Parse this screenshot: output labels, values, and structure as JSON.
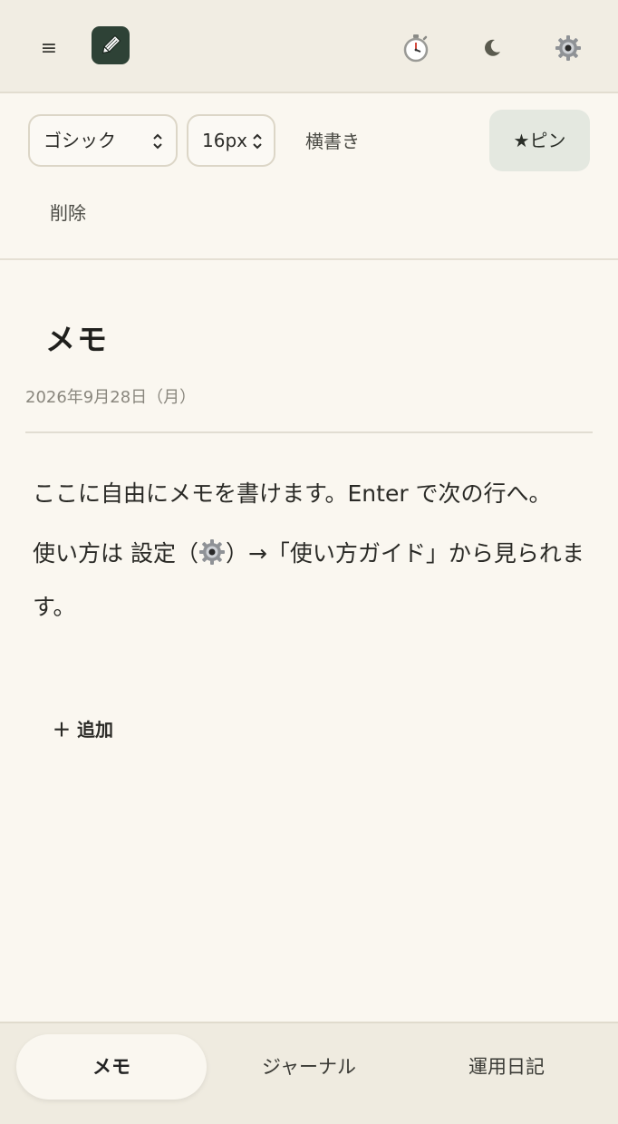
{
  "header": {
    "menu_glyph": "≡",
    "logo_icon": "pencil-icon",
    "timer_icon": "stopwatch-icon",
    "theme_icon": "moon-icon",
    "settings_icon": "gear-icon"
  },
  "toolbar": {
    "font_family": "ゴシック",
    "font_size": "16px",
    "writing_mode": "横書き",
    "pin_label": "★ピン",
    "delete_label": "削除"
  },
  "memo": {
    "title": "メモ",
    "date": "2026年9月28日（月）",
    "line1": "ここに自由にメモを書けます。Enter で次の行へ。",
    "line2_before": "使い方は 設定（",
    "line2_after": "）→「使い方ガイド」から見られます。",
    "add_label": "＋ 追加"
  },
  "tabs": [
    {
      "label": "メモ",
      "active": true
    },
    {
      "label": "ジャーナル",
      "active": false
    },
    {
      "label": "運用日記",
      "active": false
    }
  ],
  "colors": {
    "background": "#faf7f0",
    "header": "#f1ede3",
    "logo": "#2e4236",
    "pin_bg": "#e4e8e0"
  }
}
